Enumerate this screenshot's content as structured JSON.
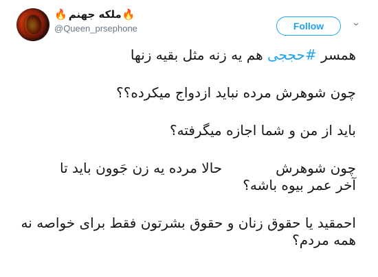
{
  "user": {
    "display_name": "ملکه جهنم",
    "handle": "@Queen_prsephone",
    "avatar_icon": "fire-avatar-icon",
    "flame_left": "🔥",
    "flame_right": "🔥"
  },
  "actions": {
    "follow_label": "Follow",
    "menu_icon": "⌄"
  },
  "tweet": {
    "line_1_before_hashtag": "همسر ",
    "hashtag": "#حججی",
    "line_1_after_hashtag": " هم یه زنه مثل بقیه زنها",
    "line_2": "چون شوهرش مرده نباید ازدواج میکرده؟؟",
    "line_3": "باید از من و شما اجازه میگرفته؟",
    "line_4_part_1": "چون شوهرش",
    "line_4_part_2": "حالا مرده یه زن جَوون باید تا",
    "line_5": "آخر عمر بیوه باشه؟",
    "line_6": "احمقید یا حقوق زنان و حقوق بشرتون فقط برای خواصه نه",
    "line_7": "همه مردم؟"
  },
  "colors": {
    "accent": "#1da1f2",
    "text": "#14171a",
    "muted": "#657786",
    "flame": "#ff6b00"
  }
}
